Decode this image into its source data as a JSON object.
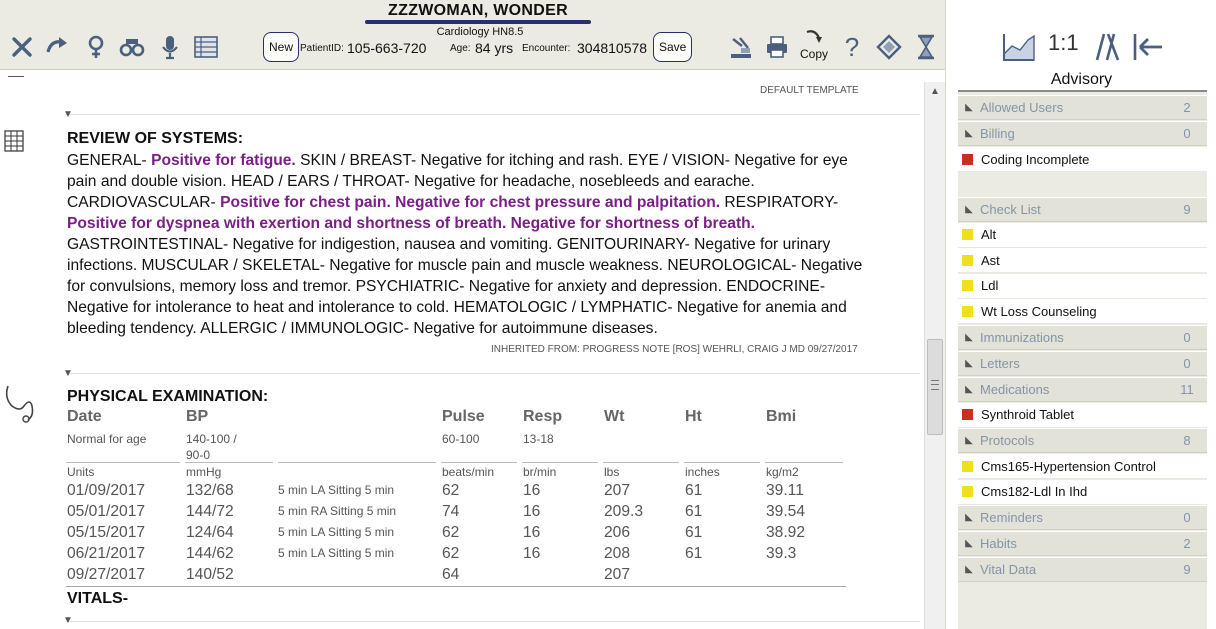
{
  "header": {
    "patient_name": "ZZZWOMAN, WONDER",
    "department": "Cardiology HN8.5",
    "new_label": "New",
    "save_label": "Save",
    "patient_id_label": "PatientID:",
    "patient_id": "105-663-720",
    "age_label": "Age:",
    "age": "84 yrs",
    "encounter_label": "Encounter:",
    "encounter": "304810578",
    "copy_label": "Copy",
    "help_glyph": "?",
    "icons": [
      "close-x-icon",
      "undo-arrow-icon",
      "female-gender-icon",
      "binoculars-icon",
      "microphone-icon",
      "grid-list-icon",
      "transfer-icon",
      "printer-icon",
      "copy-icon",
      "help-icon",
      "diamond-icon",
      "hourglass-icon"
    ]
  },
  "document": {
    "template_label": "DEFAULT TEMPLATE",
    "ros_title": "REVIEW OF SYSTEMS:",
    "ros_segments": [
      {
        "t": "GENERAL- ",
        "p": false
      },
      {
        "t": "Positive for fatigue.",
        "p": true
      },
      {
        "t": " SKIN / BREAST- Negative for itching and rash. EYE / VISION- Negative for eye pain and double vision. HEAD / EARS / THROAT- Negative for headache, nosebleeds and earache. CARDIOVASCULAR- ",
        "p": false
      },
      {
        "t": "Positive for chest pain. Negative for chest pressure and palpitation.",
        "p": true
      },
      {
        "t": " RESPIRATORY- ",
        "p": false
      },
      {
        "t": "Positive for dyspnea with exertion and shortness of breath. Negative for shortness of breath.",
        "p": true
      },
      {
        "t": " GASTROINTESTINAL- Negative for indigestion, nausea and vomiting. GENITOURINARY- Negative for urinary infections. MUSCULAR / SKELETAL- Negative for muscle pain and muscle weakness. NEUROLOGICAL- Negative for convulsions, memory loss and tremor. PSYCHIATRIC- Negative for anxiety and depression. ENDOCRINE- Negative for intolerance to heat and intolerance to cold. HEMATOLOGIC / LYMPHATIC- Negative for anemia and bleeding tendency. ALLERGIC / IMMUNOLOGIC- Negative for autoimmune diseases.",
        "p": false
      }
    ],
    "inherited": "INHERITED FROM: PROGRESS NOTE [ROS] WEHRLI, CRAIG J MD 09/27/2017",
    "pe_title": "PHYSICAL EXAMINATION:",
    "pe_table": {
      "headers": [
        "Date",
        "BP",
        "",
        "Pulse",
        "Resp",
        "Wt",
        "Ht",
        "Bmi"
      ],
      "normals": [
        "Normal for age",
        "140-100 / 90-0",
        "",
        "60-100",
        "13-18",
        "",
        "",
        ""
      ],
      "units": [
        "Units",
        "mmHg",
        "",
        "beats/min",
        "br/min",
        "lbs",
        "inches",
        "kg/m2"
      ],
      "rows": [
        [
          "01/09/2017",
          "132/68",
          "5 min LA Sitting 5 min",
          "62",
          "16",
          "207",
          "61",
          "39.11"
        ],
        [
          "05/01/2017",
          "144/72",
          "5 min RA Sitting 5 min",
          "74",
          "16",
          "209.3",
          "61",
          "39.54"
        ],
        [
          "05/15/2017",
          "124/64",
          "5 min LA Sitting 5 min",
          "62",
          "16",
          "206",
          "61",
          "38.92"
        ],
        [
          "06/21/2017",
          "144/62",
          "5 min LA Sitting 5 min",
          "62",
          "16",
          "208",
          "61",
          "39.3"
        ],
        [
          "09/27/2017",
          "140/52",
          "",
          "64",
          "",
          "207",
          "",
          ""
        ]
      ]
    },
    "vitals_title": "VITALS-"
  },
  "advisory": {
    "title": "Advisory",
    "icons": [
      "chart-area-icon",
      "one-to-one-icon",
      "parallel-lines-icon",
      "collapse-left-icon"
    ],
    "icon_text_one": "1:1",
    "items": [
      {
        "kind": "cat",
        "label": "Allowed Users",
        "count": "2"
      },
      {
        "kind": "cat",
        "label": "Billing",
        "count": "0"
      },
      {
        "kind": "item",
        "label": "Coding Incomplete",
        "color": "#c8301e"
      },
      {
        "kind": "cat",
        "label": "Check List",
        "count": "9"
      },
      {
        "kind": "item",
        "label": "Alt",
        "color": "#f0e01a"
      },
      {
        "kind": "item",
        "label": "Ast",
        "color": "#f0e01a"
      },
      {
        "kind": "item",
        "label": "Ldl",
        "color": "#f0e01a"
      },
      {
        "kind": "item",
        "label": "Wt Loss Counseling",
        "color": "#f0e01a"
      },
      {
        "kind": "cat",
        "label": "Immunizations",
        "count": "0"
      },
      {
        "kind": "cat",
        "label": "Letters",
        "count": "0"
      },
      {
        "kind": "cat",
        "label": "Medications",
        "count": "11"
      },
      {
        "kind": "item",
        "label": "Synthroid Tablet",
        "color": "#c8301e"
      },
      {
        "kind": "cat",
        "label": "Protocols",
        "count": "8"
      },
      {
        "kind": "item",
        "label": "Cms165-Hypertension Control",
        "color": "#f0e01a"
      },
      {
        "kind": "item",
        "label": "Cms182-Ldl In Ihd",
        "color": "#f0e01a"
      },
      {
        "kind": "cat",
        "label": "Reminders",
        "count": "0"
      },
      {
        "kind": "cat",
        "label": "Habits",
        "count": "2"
      },
      {
        "kind": "cat",
        "label": "Vital Data",
        "count": "9"
      }
    ]
  }
}
